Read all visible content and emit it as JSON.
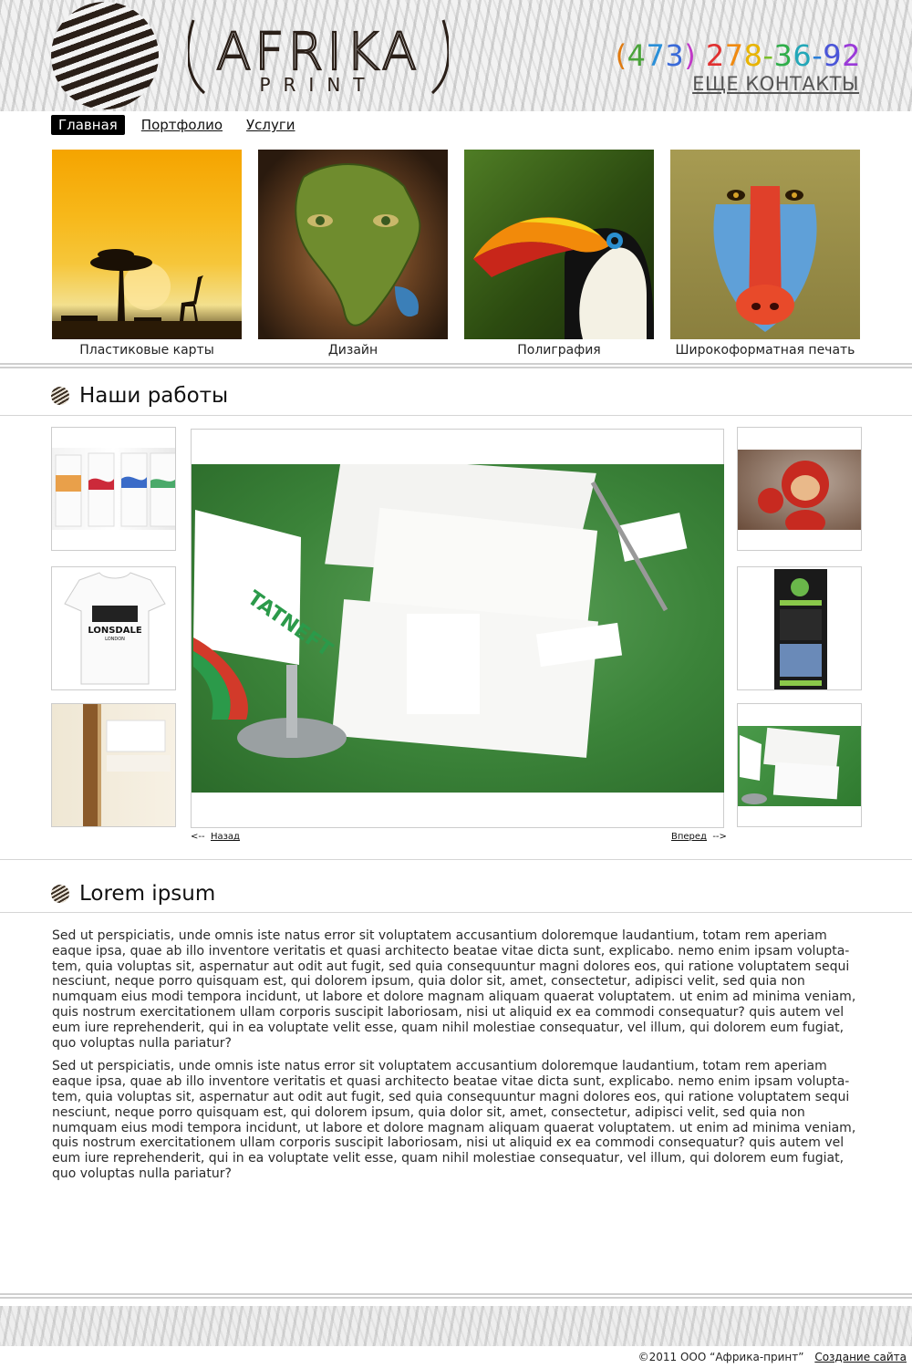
{
  "header": {
    "logo_text": "AFRIKA",
    "logo_subtext": "PRINT",
    "phone_parts": [
      {
        "text": "(",
        "color": "#e07a10"
      },
      {
        "text": "4",
        "color": "#4aa33a"
      },
      {
        "text": "7",
        "color": "#2a8fd8"
      },
      {
        "text": "3",
        "color": "#3a6ad8"
      },
      {
        "text": ")",
        "color": "#c13ac7"
      },
      {
        "text": " ",
        "color": "#000000"
      },
      {
        "text": "2",
        "color": "#e03030"
      },
      {
        "text": "7",
        "color": "#f08a10"
      },
      {
        "text": "8",
        "color": "#e8b400"
      },
      {
        "text": "-",
        "color": "#7abf2a"
      },
      {
        "text": "3",
        "color": "#2fae4a"
      },
      {
        "text": "6",
        "color": "#23a7b8"
      },
      {
        "text": "-",
        "color": "#2b7fd8"
      },
      {
        "text": "9",
        "color": "#4a55d8"
      },
      {
        "text": "2",
        "color": "#9a3ad8"
      }
    ],
    "contacts_link": "ЕЩЕ КОНТАКТЫ"
  },
  "nav": {
    "items": [
      {
        "label": "Главная",
        "active": true
      },
      {
        "label": "Портфолио",
        "active": false
      },
      {
        "label": "Услуги",
        "active": false
      }
    ]
  },
  "tiles": [
    {
      "caption": "Пластиковые карты",
      "icon": "savanna-sunset-image"
    },
    {
      "caption": "Дизайн",
      "icon": "africa-face-image"
    },
    {
      "caption": "Полиграфия",
      "icon": "toucan-image"
    },
    {
      "caption": "Широкоформатная печать",
      "icon": "mandrill-image"
    }
  ],
  "works": {
    "title": "Наши работы",
    "prev_label": "Назад",
    "next_label": "Вперед",
    "prev_arrow": "<--",
    "next_arrow": "-->",
    "tshirt_text": "LONSDALE",
    "tshirt_subtext": "LONDON",
    "brand_text": "TATNEFT"
  },
  "lorem": {
    "title": "Lorem ipsum",
    "paragraphs": [
      "Sed ut perspiciatis, unde omnis iste natus error sit voluptatem accusantium doloremque laudantium, totam rem aperiam eaque ipsa, quae ab illo inventore veritatis et quasi architecto beatae vitae dicta sunt, explicabo. nemo enim ipsam volupta­tem, quia voluptas sit, aspernatur aut odit aut fugit, sed quia consequuntur magni dolores eos, qui ratione voluptatem sequi nesciunt, neque porro quisquam est, qui dolorem ipsum, quia dolor sit, amet, consectetur, adipisci velit, sed quia non numquam eius modi tempora incidunt, ut labore et dolore magnam aliquam quaerat voluptatem. ut enim ad minima veniam, quis nostrum exercitationem ullam corporis suscipit laboriosam, nisi ut aliquid ex ea commodi consequatur? quis autem vel eum iure reprehenderit, qui in ea voluptate velit esse, quam nihil molestiae consequatur, vel illum, qui dolorem eum fugiat, quo voluptas nulla pariatur?",
      "Sed ut perspiciatis, unde omnis iste natus error sit voluptatem accusantium doloremque laudantium, totam rem aperiam eaque ipsa, quae ab illo inventore veritatis et quasi architecto beatae vitae dicta sunt, explicabo. nemo enim ipsam volupta­tem, quia voluptas sit, aspernatur aut odit aut fugit, sed quia consequuntur magni dolores eos, qui ratione voluptatem sequi nesciunt, neque porro quisquam est, qui dolorem ipsum, quia dolor sit, amet, consectetur, adipisci velit, sed quia non numquam eius modi tempora incidunt, ut labore et dolore magnam aliquam quaerat voluptatem. ut enim ad minima veniam, quis nostrum exercitationem ullam corporis suscipit laboriosam, nisi ut aliquid ex ea commodi consequatur? quis autem vel eum iure reprehenderit, qui in ea voluptate velit esse, quam nihil molestiae consequatur, vel illum, qui dolorem eum fugiat, quo voluptas nulla pariatur?"
    ]
  },
  "footer": {
    "copyright": "©2011  ООО “Африка-принт”",
    "site_link": "Создание сайта"
  }
}
